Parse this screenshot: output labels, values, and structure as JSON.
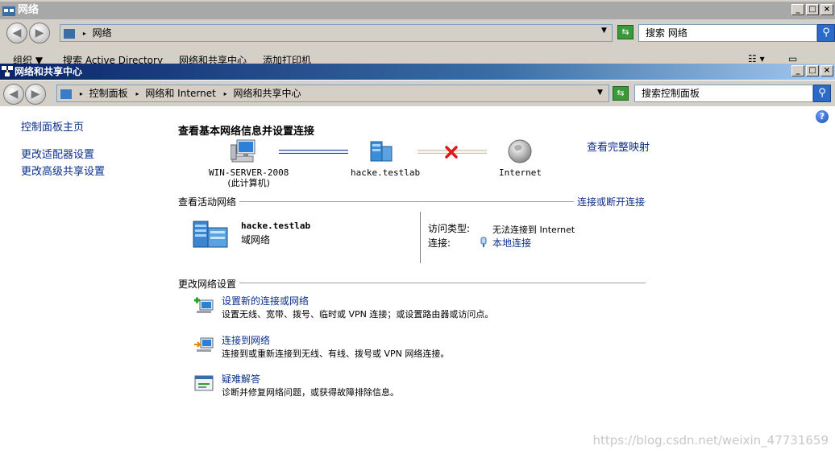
{
  "back_window": {
    "title": "网络",
    "path_label": "网络",
    "search_text": "搜索 网络",
    "toolbar": [
      "组织 ▼",
      "搜索 Active Directory",
      "网络和共享中心",
      "添加打印机"
    ],
    "min": "_",
    "max": "□",
    "close": "×"
  },
  "window": {
    "title": "网络和共享中心",
    "min": "_",
    "max": "□",
    "close": "×"
  },
  "address": {
    "crumbs": [
      "控制面板",
      "网络和 Internet",
      "网络和共享中心"
    ],
    "search_placeholder": "搜索控制面板"
  },
  "sidebar": {
    "items": [
      {
        "label": "控制面板主页"
      },
      {
        "label": "更改适配器设置"
      },
      {
        "label": "更改高级共享设置"
      }
    ]
  },
  "main": {
    "heading": "查看基本网络信息并设置连接",
    "full_map_link": "查看完整映射",
    "map": {
      "computer_name": "WIN-SERVER-2008",
      "computer_note": "(此计算机)",
      "domain": "hacke.testlab",
      "internet": "Internet"
    },
    "active_networks": {
      "heading": "查看活动网络",
      "connect_link": "连接或断开连接",
      "network_name": "hacke.testlab",
      "network_kind": "域网络",
      "access_type_label": "访问类型:",
      "access_type_value": "无法连接到 Internet",
      "connection_label": "连接:",
      "connection_value": "本地连接"
    },
    "change_settings": {
      "heading": "更改网络设置",
      "tasks": [
        {
          "title": "设置新的连接或网络",
          "desc": "设置无线、宽带、拨号、临时或 VPN 连接；或设置路由器或访问点。"
        },
        {
          "title": "连接到网络",
          "desc": "连接到或重新连接到无线、有线、拨号或 VPN 网络连接。"
        },
        {
          "title": "疑难解答",
          "desc": "诊断并修复网络问题，或获得故障排除信息。"
        }
      ]
    }
  },
  "watermark": "https://blog.csdn.net/weixin_47731659",
  "colors": {
    "link": "#0b2f8a",
    "title_active": "#0a246a",
    "title_inactive": "#a8a8a8",
    "face": "#d4d0c8"
  },
  "icons": [
    "computer-icon",
    "server-icon",
    "globe-icon",
    "x-mark-icon",
    "network-building-icon",
    "plug-icon",
    "new-connection-icon",
    "connect-network-icon",
    "troubleshoot-icon",
    "help-icon",
    "search-icon",
    "go-icon",
    "back-icon",
    "forward-icon"
  ]
}
